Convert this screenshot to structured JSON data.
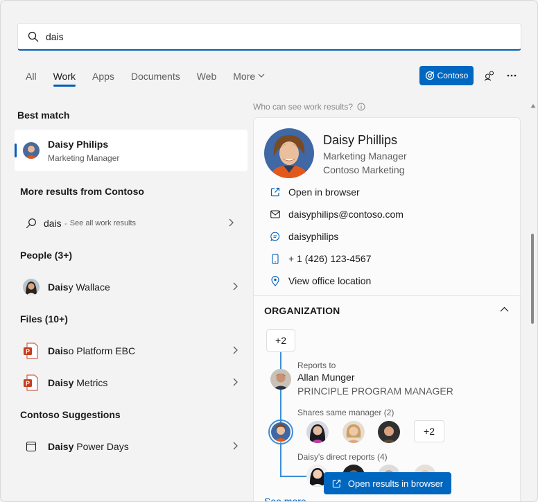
{
  "search": {
    "value": "dais",
    "placeholder": ""
  },
  "tabs": [
    {
      "label": "All"
    },
    {
      "label": "Work"
    },
    {
      "label": "Apps"
    },
    {
      "label": "Documents"
    },
    {
      "label": "Web"
    },
    {
      "label": "More"
    }
  ],
  "header": {
    "org_button": "Contoso"
  },
  "left": {
    "best_match_title": "Best match",
    "best_match": {
      "name": "Daisy Philips",
      "title": "Marketing Manager"
    },
    "more_results_title": "More results from Contoso",
    "search_row": {
      "query": "dais",
      "separator": "-",
      "hint": "See all work results"
    },
    "people_title": "People (3+)",
    "people": [
      {
        "bold": "Dais",
        "rest": "y Wallace"
      }
    ],
    "files_title": "Files (10+)",
    "files": [
      {
        "bold": "Dais",
        "rest": "o Platform EBC"
      },
      {
        "bold": "Daisy",
        "rest": " Metrics"
      }
    ],
    "suggestions_title": "Contoso Suggestions",
    "suggestions": [
      {
        "bold": "Daisy",
        "rest": " Power Days"
      }
    ]
  },
  "right": {
    "who_can_see": "Who can see work results?",
    "profile": {
      "name": "Daisy Phillips",
      "title": "Marketing Manager",
      "department": "Contoso Marketing"
    },
    "actions": [
      {
        "label": "Open in browser",
        "icon": "open-external-icon"
      },
      {
        "label": "daisyphilips@contoso.com",
        "icon": "mail-icon"
      },
      {
        "label": "daisyphilips",
        "icon": "chat-icon"
      },
      {
        "label": "+ 1 (426) 123-4567",
        "icon": "phone-icon"
      },
      {
        "label": "View office location",
        "icon": "location-icon"
      }
    ],
    "org": {
      "title": "ORGANIZATION",
      "up_count": "+2",
      "reports_to_label": "Reports to",
      "manager_name": "Allan Munger",
      "manager_title": "PRINCIPLE PROGRAM MANAGER",
      "same_manager_label": "Shares same manager (2)",
      "peers_more": "+2",
      "direct_reports_label": "Daisy's direct reports (4)"
    },
    "see_more": "See more"
  },
  "footer": {
    "open_results": "Open results in browser"
  },
  "colors": {
    "accent": "#0067c0",
    "underline": "#005fb8"
  }
}
